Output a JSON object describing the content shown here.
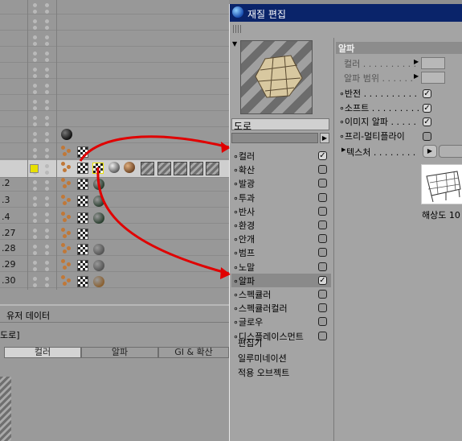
{
  "object_manager": {
    "row_labels": [
      ".2",
      ".3",
      ".4",
      ".27",
      ".28",
      ".29",
      ".30"
    ]
  },
  "bottom_panel": {
    "header_label": "유저 데이터",
    "object_name": "도로]",
    "tabs": [
      {
        "label": "컬러",
        "active": true
      },
      {
        "label": "알파",
        "active": false
      },
      {
        "label": "GI & 확산",
        "active": false
      }
    ]
  },
  "material_editor": {
    "window_title": "재질 편집",
    "material_name": "도로",
    "channels": [
      {
        "label": "컬러",
        "checked": true
      },
      {
        "label": "확산",
        "checked": false
      },
      {
        "label": "발광",
        "checked": false
      },
      {
        "label": "투과",
        "checked": false
      },
      {
        "label": "반사",
        "checked": false
      },
      {
        "label": "환경",
        "checked": false
      },
      {
        "label": "안개",
        "checked": false
      },
      {
        "label": "범프",
        "checked": false
      },
      {
        "label": "노말",
        "checked": false
      },
      {
        "label": "알파",
        "checked": true
      },
      {
        "label": "스펙큘러",
        "checked": false
      },
      {
        "label": "스펙큘러컬러",
        "checked": false
      },
      {
        "label": "글로우",
        "checked": false
      },
      {
        "label": "디스플레이스먼트",
        "checked": false
      }
    ],
    "extra_items": [
      "편집기",
      "일루미네이션",
      "적용 오브젝트"
    ],
    "alpha_panel": {
      "heading": "알파",
      "color_label": "컬러 . . . . . . . . . .",
      "alpha_range_label": "알파 범위 . . . . . .",
      "options": [
        {
          "label": "반전 . . . . . . . . . .",
          "checked": true
        },
        {
          "label": "소프트 . . . . . . . . .",
          "checked": true
        },
        {
          "label": "이미지 알파 . . . . .",
          "checked": true
        },
        {
          "label": "프리-멀티플라이",
          "checked": false
        }
      ],
      "texture_label": "텍스처 . . . . . . . .",
      "resolution_label": "해상도 10"
    }
  },
  "colors": {
    "title_bar": "#0a246a",
    "selected_row": "#cfcfcf",
    "annotation_arrow": "#e00000",
    "tag_yellow": "#e8e000"
  }
}
